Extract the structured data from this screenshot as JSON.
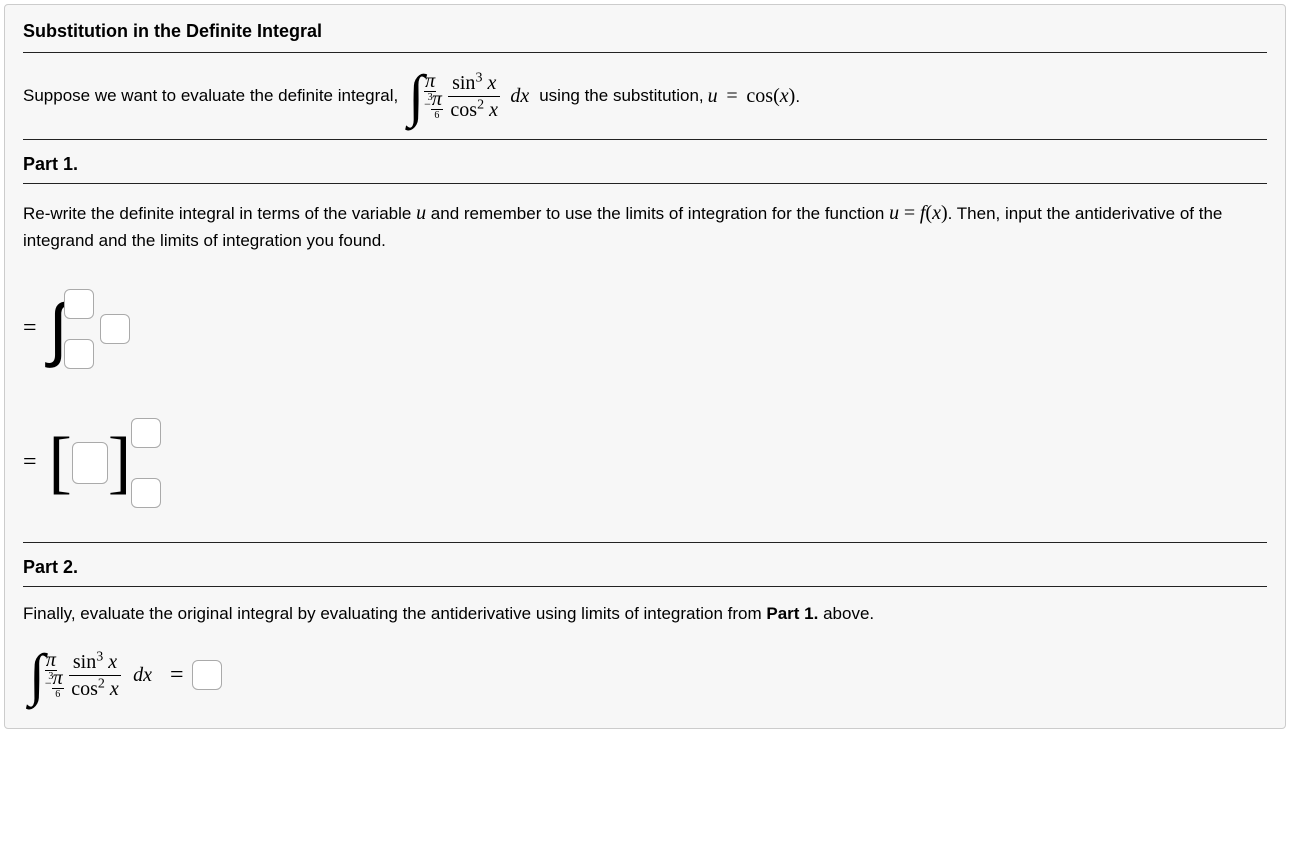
{
  "title": "Substitution in the Definite Integral",
  "intro": {
    "lead": "Suppose we want to evaluate the definite integral,",
    "tail_a": "using the substitution,",
    "sub_lhs_var": "u",
    "sub_eq": "=",
    "sub_rhs_fn": "cos",
    "sub_rhs_arg": "x",
    "period": "."
  },
  "integral": {
    "upper_num": "π",
    "upper_den": "3",
    "lower_neg": "−",
    "lower_num": "π",
    "lower_den": "6",
    "num_fn": "sin",
    "num_exp": "3",
    "num_arg": "x",
    "den_fn": "cos",
    "den_exp": "2",
    "den_arg": "x",
    "dx": "dx"
  },
  "part1": {
    "heading": "Part 1.",
    "text_a": "Re-write the definite integral in terms of the variable ",
    "var_u": "u",
    "text_b": " and remember to use the limits of integration for the function ",
    "eq_uf": "u = f(x)",
    "text_c": ". Then, input the antiderivative of the integrand and the limits of integration you found."
  },
  "eq": {
    "equals": "="
  },
  "part2": {
    "heading": "Part 2.",
    "text": "Finally, evaluate the original integral by evaluating the antiderivative using limits of integration from ",
    "ref": "Part 1.",
    "text_tail": " above.",
    "equals": "="
  }
}
